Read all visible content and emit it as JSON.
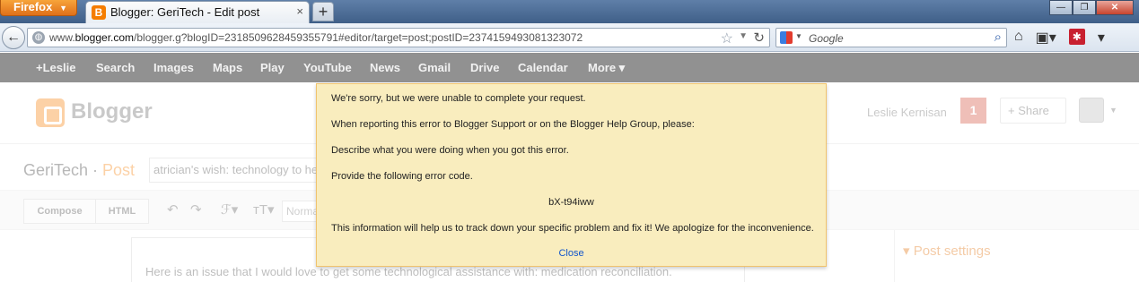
{
  "browser": {
    "menu_button": "Firefox",
    "tab_title": "Blogger: GeriTech - Edit post",
    "tab_favicon": "B",
    "tab_close": "×",
    "new_tab": "+",
    "url_prefix": "www.",
    "url_domain": "blogger.com",
    "url_rest": "/blogger.g?blogID=2318509628459355791#editor/target=post;postID=2374159493081323072",
    "search_placeholder": "Google"
  },
  "google_bar": {
    "links": [
      "+Leslie",
      "Search",
      "Images",
      "Maps",
      "Play",
      "YouTube",
      "News",
      "Gmail",
      "Drive",
      "Calendar",
      "More ▾"
    ]
  },
  "blogger": {
    "logo_text": "Blogger",
    "user_name": "Leslie Kernisan",
    "notification_count": "1",
    "share_label": "+ Share",
    "blog_name": "GeriTech",
    "separator": " · ",
    "page_label": "Post",
    "post_title_value": "atrician's wish: technology to he",
    "compose_label": "Compose",
    "html_label": "HTML",
    "format_value": "Norma",
    "editor_text": "Here is an issue that I would love to get some technological assistance with: medication reconciliation.",
    "post_settings_label": "▾  Post settings"
  },
  "dialog": {
    "line1": "We're sorry, but we were unable to complete your request.",
    "line2": "When reporting this error to Blogger Support or on the Blogger Help Group, please:",
    "line3": "Describe what you were doing when you got this error.",
    "line4": "Provide the following error code.",
    "error_code": "bX-t94iww",
    "line5": "This information will help us to track down your specific problem and fix it! We apologize for the inconvenience.",
    "close_label": "Close"
  },
  "colors": {
    "blogger_orange": "#f57d00",
    "dialog_bg": "#f9edbe",
    "dialog_border": "#f0c36d",
    "link_blue": "#1155cc"
  }
}
